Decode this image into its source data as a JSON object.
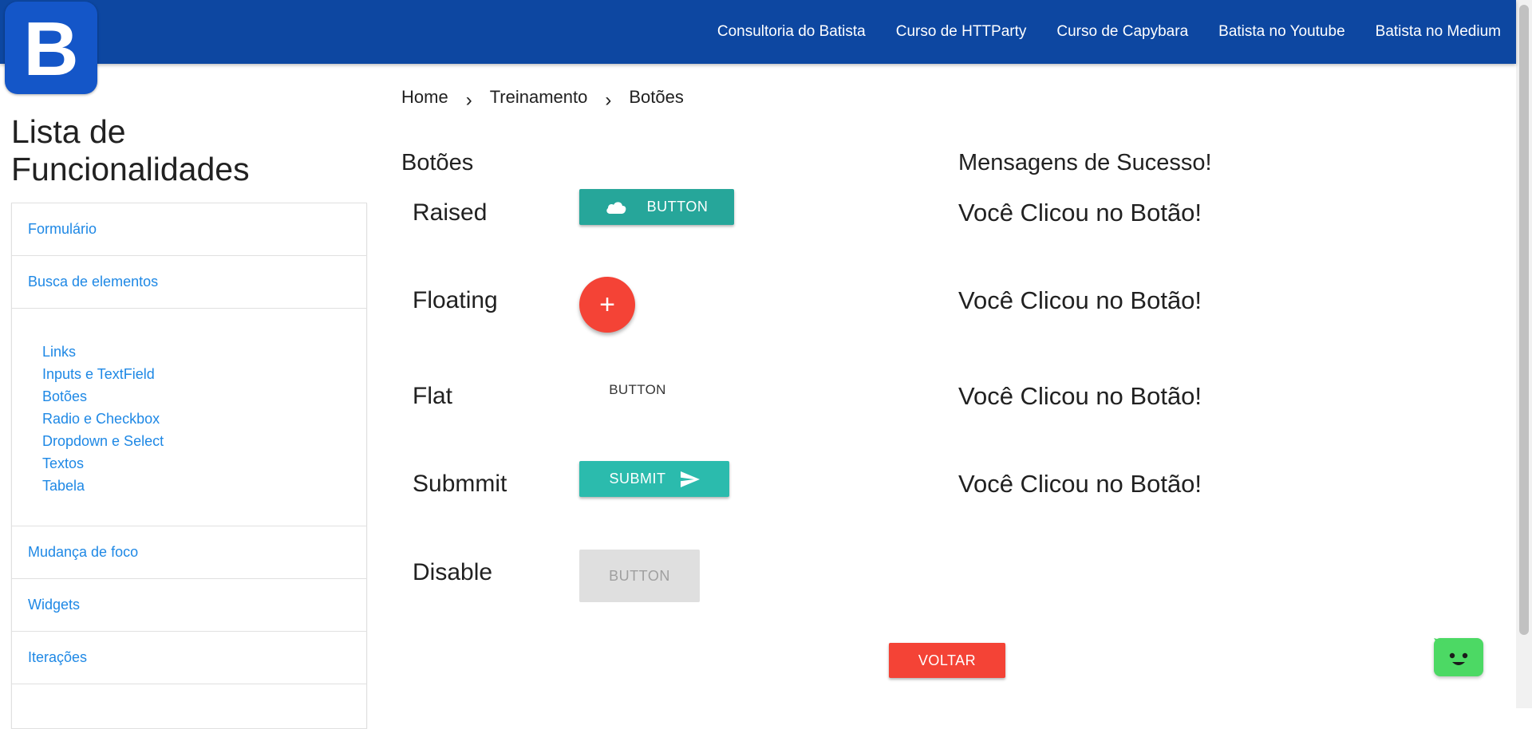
{
  "logo": {
    "letter": "B"
  },
  "nav": {
    "items": [
      "Consultoria do Batista",
      "Curso de HTTParty",
      "Curso de Capybara",
      "Batista no Youtube",
      "Batista no Medium"
    ]
  },
  "sidebar": {
    "title": "Lista de Funcionalidades",
    "items_top": [
      "Formulário",
      "Busca de elementos"
    ],
    "sub_items": [
      "Links",
      "Inputs e TextField",
      "Botões",
      "Radio e Checkbox",
      "Dropdown e Select",
      "Textos",
      "Tabela"
    ],
    "items_bottom": [
      "Mudança de foco",
      "Widgets",
      "Iterações"
    ]
  },
  "breadcrumb": {
    "items": [
      "Home",
      "Treinamento",
      "Botões"
    ],
    "separator": "›"
  },
  "main": {
    "title": "Botões",
    "messages_title": "Mensagens de Sucesso!",
    "rows": [
      {
        "label": "Raised",
        "button": "BUTTON",
        "icon": "cloud-icon",
        "message": "Você Clicou no Botão!"
      },
      {
        "label": "Floating",
        "button": "+",
        "icon": "plus-icon",
        "message": "Você Clicou no Botão!"
      },
      {
        "label": "Flat",
        "button": "BUTTON",
        "message": "Você Clicou no Botão!"
      },
      {
        "label": "Submmit",
        "button": "SUBMIT",
        "icon": "send-icon",
        "message": "Você Clicou no Botão!"
      },
      {
        "label": "Disable",
        "button": "BUTTON",
        "message": ""
      }
    ],
    "back_button": "VOLTAR"
  },
  "colors": {
    "navbar": "#0d47a1",
    "teal": "#26a69a",
    "red": "#f44336",
    "link": "#1e88e5",
    "chat": "#4cd964"
  }
}
